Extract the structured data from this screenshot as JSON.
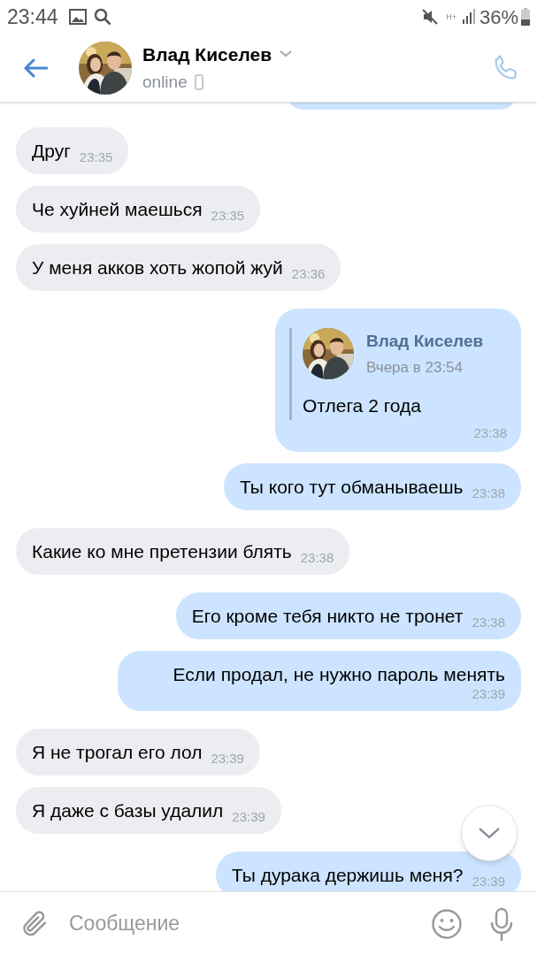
{
  "status_bar": {
    "time": "23:44",
    "network": "H+",
    "battery": "36%"
  },
  "header": {
    "name": "Влад Киселев",
    "presence": "online"
  },
  "messages": [
    {
      "kind": "stub",
      "outgoing": true
    },
    {
      "kind": "text",
      "outgoing": false,
      "text": "Друг",
      "time": "23:35"
    },
    {
      "kind": "text",
      "outgoing": false,
      "text": "Че хуйней маешься",
      "time": "23:35"
    },
    {
      "kind": "text",
      "outgoing": false,
      "text": "У меня акков хоть жопой жуй",
      "time": "23:36"
    },
    {
      "kind": "forward",
      "outgoing": true,
      "author": "Влад Киселев",
      "date": "Вчера в 23:54",
      "text": "Отлега 2 года",
      "time": "23:38"
    },
    {
      "kind": "text",
      "outgoing": true,
      "text": "Ты кого тут обманываешь",
      "time": "23:38"
    },
    {
      "kind": "text",
      "outgoing": false,
      "text": "Какие ко мне претензии блять",
      "time": "23:38"
    },
    {
      "kind": "text",
      "outgoing": true,
      "text": "Его кроме тебя никто не тронет",
      "time": "23:38"
    },
    {
      "kind": "text",
      "outgoing": true,
      "text": "Если продал, не нужно пароль менять",
      "time": "23:39"
    },
    {
      "kind": "text",
      "outgoing": false,
      "text": "Я не трогал его лол",
      "time": "23:39"
    },
    {
      "kind": "text",
      "outgoing": false,
      "text": "Я даже с базы удалил",
      "time": "23:39"
    },
    {
      "kind": "text",
      "outgoing": true,
      "text": "Ты дурака держишь меня?",
      "time": "23:39"
    }
  ],
  "composer": {
    "placeholder": "Сообщение"
  }
}
